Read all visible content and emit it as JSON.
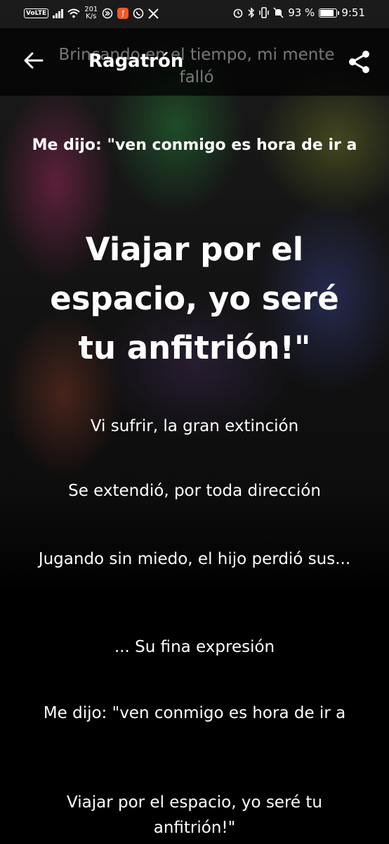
{
  "status_bar": {
    "volte": "VoLTE",
    "net_speed_value": "201",
    "net_speed_unit": "K/s",
    "battery_percent": "93 %",
    "battery_level": 0.93,
    "time": "9:51",
    "icons": [
      "signal-icon",
      "wifi-icon",
      "data-saver-icon",
      "app-icon",
      "whatsapp-icon",
      "x-icon",
      "alarm-icon",
      "bluetooth-icon",
      "vibrate-icon",
      "mute-icon",
      "battery-icon"
    ]
  },
  "header": {
    "title": "Ragatrón",
    "ghost_line": "Brincando en el tiempo, mi mente falló"
  },
  "lyrics": [
    "Me dijo: \"ven conmigo es hora de ir a",
    "Viajar por el espacio, yo seré tu anfitrión!\"",
    "Vi sufrir, la gran extinción",
    "Se extendió, por toda dirección",
    "Jugando sin miedo, el hijo perdió sus...",
    "... Su fina expresión",
    "Me dijo: \"ven conmigo es hora de ir a",
    "Viajar por el espacio, yo seré tu anfitrión!\""
  ]
}
